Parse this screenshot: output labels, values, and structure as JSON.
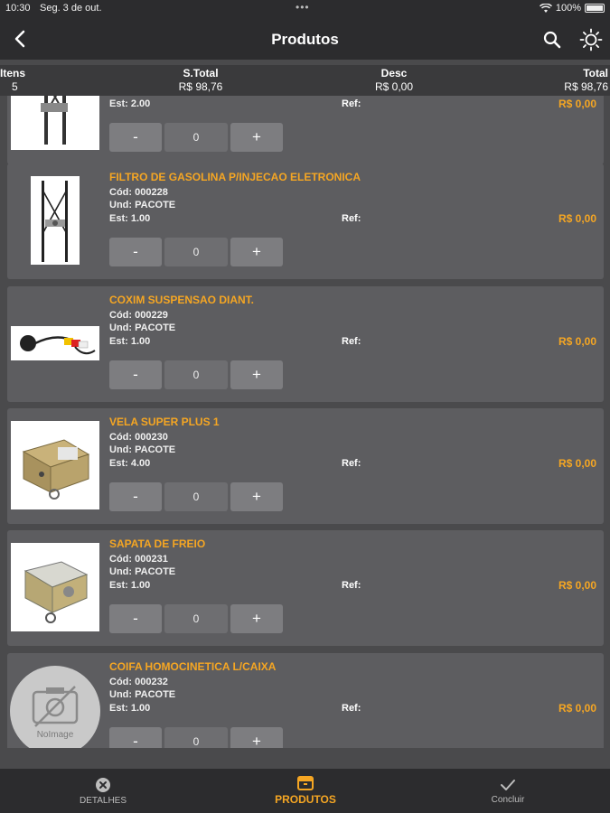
{
  "status_bar": {
    "time": "10:30",
    "date": "Seg. 3 de out.",
    "dots": "•••",
    "battery": "100%"
  },
  "app_bar": {
    "title": "Produtos"
  },
  "summary": {
    "itens_label": "Itens",
    "itens_value": "5",
    "stotal_label": "S.Total",
    "stotal_value": "R$ 98,76",
    "desc_label": "Desc",
    "desc_value": "R$ 0,00",
    "total_label": "Total",
    "total_value": "R$ 98,76"
  },
  "products": [
    {
      "name": "",
      "cod": "",
      "und": "",
      "est": "Est: 2.00",
      "ref": "Ref:",
      "price": "R$ 0,00",
      "qty": "0"
    },
    {
      "name": "FILTRO DE GASOLINA P/INJECAO ELETRONICA",
      "cod": "Cód: 000228",
      "und": "Und: PACOTE",
      "est": "Est: 1.00",
      "ref": "Ref:",
      "price": "R$ 0,00",
      "qty": "0"
    },
    {
      "name": "COXIM SUSPENSAO DIANT.",
      "cod": "Cód: 000229",
      "und": "Und: PACOTE",
      "est": "Est: 1.00",
      "ref": "Ref:",
      "price": "R$ 0,00",
      "qty": "0"
    },
    {
      "name": "VELA SUPER PLUS 1",
      "cod": "Cód: 000230",
      "und": "Und: PACOTE",
      "est": "Est: 4.00",
      "ref": "Ref:",
      "price": "R$ 0,00",
      "qty": "0"
    },
    {
      "name": "SAPATA DE FREIO",
      "cod": "Cód: 000231",
      "und": "Und: PACOTE",
      "est": "Est: 1.00",
      "ref": "Ref:",
      "price": "R$ 0,00",
      "qty": "0"
    },
    {
      "name": "COIFA HOMOCINETICA L/CAIXA",
      "cod": "Cód: 000232",
      "und": "Und: PACOTE",
      "est": "Est: 1.00",
      "ref": "Ref:",
      "price": "R$ 0,00",
      "qty": "0",
      "noimage_label": "NoImage"
    }
  ],
  "stepper": {
    "minus": "-",
    "plus": "+"
  },
  "tabs": {
    "detalhes": "DETALHES",
    "produtos": "PRODUTOS",
    "concluir": "Concluir"
  },
  "colors": {
    "accent": "#f5a623",
    "background": "#4a4a4c",
    "card": "#5d5d60",
    "bar": "#2c2c2e"
  },
  "icons": {
    "back": "chevron-left-icon",
    "search": "search-icon",
    "theme": "sun-icon",
    "detalhes": "close-circle-icon",
    "produtos": "box-icon",
    "concluir": "check-icon"
  }
}
